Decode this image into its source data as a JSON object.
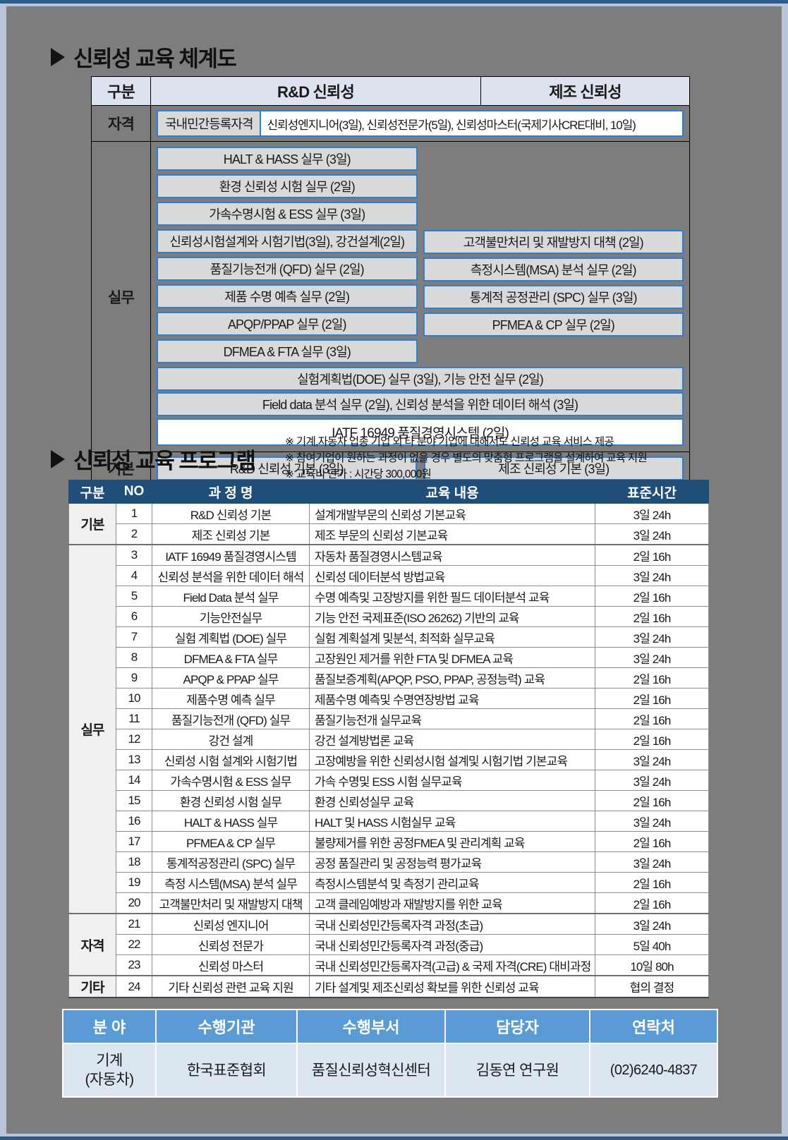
{
  "sections": {
    "system_map_title": "신뢰성 교육 체계도",
    "program_title": "신뢰성 교육 프로그램"
  },
  "notes": [
    "※ 기계,자동차 업종 기업 외 타 분야 기업에 대해서도 신뢰성 교육 서비스 제공",
    "※ 참여기업이 원하는 과정이 없을 경우 별도의 맞춤형 프로그램을 설계하여 교육 지원",
    "※ 교육비 단가 : 시간당 300,000원"
  ],
  "system_map": {
    "headers": [
      "구분",
      "R&D 신뢰성",
      "제조 신뢰성"
    ],
    "rows": {
      "qualification": {
        "label": "자격",
        "tag": "국내민간등록자격",
        "value": "신뢰성엔지니어(3일), 신뢰성전문가(5일), 신뢰성마스터(국제기사CRE대비, 10일)"
      },
      "practice": {
        "label": "실무",
        "left": [
          "HALT & HASS 실무 (3일)",
          "환경 신뢰성 시험 실무 (2일)",
          "가속수명시험 & ESS 실무 (3일)",
          "신뢰성시험설계와 시험기법(3일), 강건설계(2일)",
          "품질기능전개 (QFD) 실무 (2일)",
          "제품 수명 예측 실무 (2일)",
          "APQP/PPAP 실무 (2일)",
          "DFMEA & FTA 실무 (3일)"
        ],
        "right": [
          "고객불만처리 및 재발방지 대책 (2일)",
          "측정시스템(MSA) 분석 실무 (2일)",
          "통계적 공정관리 (SPC) 실무 (3일)",
          "PFMEA & CP 실무 (2일)"
        ],
        "full": [
          "실험계획법(DOE) 실무 (3일), 기능 안전 실무 (2일)",
          "Field data 분석 실무 (2일), 신뢰성 분석을 위한 데이터 해석 (3일)"
        ],
        "highlight": "IATF 16949 품질경영시스템 (2일)"
      },
      "basic": {
        "label": "기본",
        "left": "R&D 신뢰성 기본 (3일)",
        "right": "제조 신뢰성 기본 (3일)"
      }
    }
  },
  "program_table": {
    "headers": [
      "구분",
      "NO",
      "과 정 명",
      "교육 내용",
      "표준시간"
    ],
    "groups": [
      {
        "label": "기본",
        "rows": [
          {
            "no": "1",
            "name": "R&D 신뢰성 기본",
            "desc": "설계개발부문의 신뢰성 기본교육",
            "hours": "3일 24h"
          },
          {
            "no": "2",
            "name": "제조 신뢰성 기본",
            "desc": "제조 부문의 신뢰성 기본교육",
            "hours": "3일 24h"
          }
        ]
      },
      {
        "label": "실무",
        "rows": [
          {
            "no": "3",
            "name": "IATF 16949 품질경영시스템",
            "desc": "자동차 품질경영시스템교육",
            "hours": "2일 16h"
          },
          {
            "no": "4",
            "name": "신뢰성 분석을 위한 데이터 해석",
            "desc": "신뢰성 데이터분석 방법교육",
            "hours": "3일 24h"
          },
          {
            "no": "5",
            "name": "Field Data 분석 실무",
            "desc": "수명 예측및 고장방지를 위한 필드 데이터분석 교육",
            "hours": "2일 16h"
          },
          {
            "no": "6",
            "name": "기능안전실무",
            "desc": "기능 안전 국제표준(ISO 26262) 기반의 교육",
            "hours": "2일 16h"
          },
          {
            "no": "7",
            "name": "실험 계획법 (DOE) 실무",
            "desc": "실험 계획설계 및분석, 최적화 실무교육",
            "hours": "3일 24h"
          },
          {
            "no": "8",
            "name": "DFMEA & FTA 실무",
            "desc": "고장원인 제거를 위한 FTA 및 DFMEA 교육",
            "hours": "3일 24h"
          },
          {
            "no": "9",
            "name": "APQP & PPAP 실무",
            "desc": "품질보증계획(APQP, PSO, PPAP, 공정능력) 교육",
            "hours": "2일 16h"
          },
          {
            "no": "10",
            "name": "제품수명 예측 실무",
            "desc": "제품수명 예측및 수명연장방법 교육",
            "hours": "2일 16h"
          },
          {
            "no": "11",
            "name": "품질기능전개 (QFD) 실무",
            "desc": "품질기능전개 실무교육",
            "hours": "2일 16h"
          },
          {
            "no": "12",
            "name": "강건 설계",
            "desc": "강건 설계방법론 교육",
            "hours": "2일 16h"
          },
          {
            "no": "13",
            "name": "신뢰성 시험 설계와 시험기법",
            "desc": "고장예방을 위한 신뢰성시험 설계및 시험기법 기본교육",
            "hours": "3일 24h"
          },
          {
            "no": "14",
            "name": "가속수명시험 & ESS 실무",
            "desc": "가속 수명및 ESS 시험 실무교육",
            "hours": "3일 24h"
          },
          {
            "no": "15",
            "name": "환경 신뢰성 시험 실무",
            "desc": "환경 신뢰성실무 교육",
            "hours": "2일 16h"
          },
          {
            "no": "16",
            "name": "HALT & HASS 실무",
            "desc": "HALT 및 HASS 시험실무 교육",
            "hours": "3일 24h"
          },
          {
            "no": "17",
            "name": "PFMEA & CP 실무",
            "desc": "불량제거를 위한 공정FMEA 및 관리계획 교육",
            "hours": "2일 16h"
          },
          {
            "no": "18",
            "name": "통계적공정관리 (SPC) 실무",
            "desc": "공정 품질관리 및 공정능력 평가교육",
            "hours": "3일 24h"
          },
          {
            "no": "19",
            "name": "측정 시스템(MSA) 분석 실무",
            "desc": "측정시스템분석 및 측정기 관리교육",
            "hours": "2일 16h"
          },
          {
            "no": "20",
            "name": "고객불만처리 및 재발방지 대책",
            "desc": "고객 클레임예방과 재발방지를 위한 교육",
            "hours": "2일 16h"
          }
        ]
      },
      {
        "label": "자격",
        "rows": [
          {
            "no": "21",
            "name": "신뢰성 엔지니어",
            "desc": "국내 신뢰성민간등록자격 과정(초급)",
            "hours": "3일 24h"
          },
          {
            "no": "22",
            "name": "신뢰성 전문가",
            "desc": "국내 신뢰성민간등록자격 과정(중급)",
            "hours": "5일 40h"
          },
          {
            "no": "23",
            "name": "신뢰성 마스터",
            "desc": "국내 신뢰성민간등록자격(고급) & 국제 자격(CRE) 대비과정",
            "hours": "10일 80h"
          }
        ]
      },
      {
        "label": "기타",
        "rows": [
          {
            "no": "24",
            "name": "기타 신뢰성 관련 교육 지원",
            "desc": "기타 설계및 제조신뢰성 확보를 위한 신뢰성 교육",
            "hours": "협의 결정"
          }
        ]
      }
    ]
  },
  "contact_table": {
    "headers": [
      "분 야",
      "수행기관",
      "수행부서",
      "담당자",
      "연락처"
    ],
    "row": {
      "field_line1": "기계",
      "field_line2": "(자동차)",
      "organization": "한국표준협회",
      "department": "품질신뢰성혁신센터",
      "person": "김동연 연구원",
      "phone": "(02)6240-4837"
    }
  },
  "colors": {
    "frame": "#b9c4d6",
    "frame_accent": "#2e5b8e",
    "background": "#7d7d7d",
    "header_blue": "#1f4e79",
    "contact_header": "#5b9bd5",
    "contact_cell": "#dce6f1",
    "pill_border": "#2f7fd0",
    "map_header": "#dce3ee"
  }
}
